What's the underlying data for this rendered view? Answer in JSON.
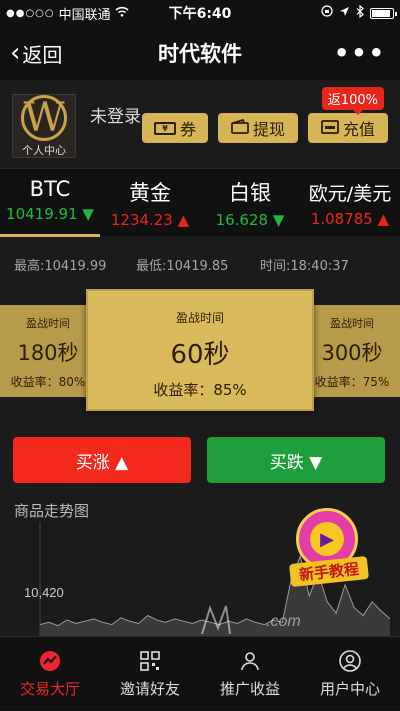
{
  "status_bar": {
    "carrier": "中国联通",
    "time": "下午6:40"
  },
  "nav": {
    "back_label": "返回",
    "title": "时代软件"
  },
  "profile": {
    "avatar_caption": "个人中心",
    "login_status": "未登录",
    "coupon_label": "券",
    "withdraw_label": "提现",
    "recharge_label": "充值",
    "recharge_badge": "返100%"
  },
  "tabs": [
    {
      "name": "BTC",
      "price": "10419.91",
      "arrow": "▼",
      "trend": "up"
    },
    {
      "name": "黄金",
      "price": "1234.23",
      "arrow": "▲",
      "trend": "down"
    },
    {
      "name": "白银",
      "price": "16.628",
      "arrow": "▼",
      "trend": "up"
    },
    {
      "name": "欧元/美元",
      "price": "1.08785",
      "arrow": "▲",
      "trend": "down"
    }
  ],
  "stats": {
    "high": "最高:10419.99",
    "low": "最低:10419.85",
    "time": "时间:18:40:37"
  },
  "cards": {
    "left": {
      "title": "盈战时间",
      "duration": "180秒",
      "rate": "收益率：80%"
    },
    "main": {
      "title": "盈战时间",
      "duration": "60秒",
      "rate": "收益率：85%"
    },
    "right": {
      "title": "盈战时间",
      "duration": "300秒",
      "rate": "收益率：75%"
    }
  },
  "actions": {
    "buy_up": "买涨 ▲",
    "buy_down": "买跌 ▼"
  },
  "trend": {
    "label": "商品走势图",
    "y_label": "10,420"
  },
  "promo": {
    "label": "新手教程"
  },
  "watermark": {
    "text": ".com"
  },
  "bottom_nav": [
    {
      "label": "交易大厅",
      "icon": "chart-icon",
      "active": true
    },
    {
      "label": "邀请好友",
      "icon": "qr-icon",
      "active": false
    },
    {
      "label": "推广收益",
      "icon": "people-icon",
      "active": false
    },
    {
      "label": "用户中心",
      "icon": "user-icon",
      "active": false
    }
  ],
  "colors": {
    "gold": "#d7b556",
    "up_green": "#1fb93f",
    "down_red": "#e8261d",
    "buy_up_bg": "#f2291c",
    "buy_down_bg": "#1f9e3c",
    "active_nav": "#f0242e"
  },
  "chart_data": {
    "type": "line",
    "y_tick_labels": [
      "10,420"
    ],
    "y": [
      0.1,
      0.12,
      0.09,
      0.14,
      0.11,
      0.13,
      0.15,
      0.12,
      0.1,
      0.16,
      0.13,
      0.11,
      0.18,
      0.14,
      0.12,
      0.15,
      0.13,
      0.11,
      0.14,
      0.12,
      0.1,
      0.13,
      0.11,
      0.15,
      0.12,
      0.1,
      0.14,
      0.12,
      0.5,
      0.7,
      0.35,
      0.55,
      0.3,
      0.2,
      0.45,
      0.25,
      0.18,
      0.3,
      0.22,
      0.15
    ]
  }
}
